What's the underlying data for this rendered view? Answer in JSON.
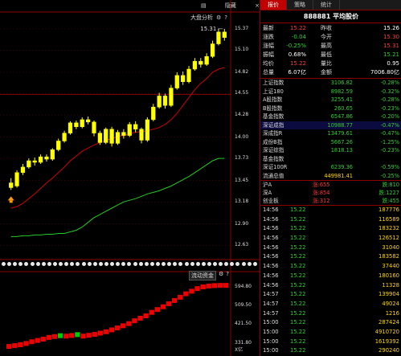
{
  "chart_toolbar": {
    "label": "大盘分析",
    "settings_icon": "⚙",
    "help_icon": "?"
  },
  "top_bar": {
    "icon": "▤",
    "hide_label": "隐藏",
    "close_icon": "×"
  },
  "price_axis": [
    "15.37",
    "15.10",
    "14.82",
    "14.55",
    "14.28",
    "14.00",
    "13.73",
    "13.45",
    "13.18",
    "12.90",
    "12.63"
  ],
  "price_marker": "15.31",
  "flow_header": {
    "label": "流动资金",
    "settings_icon": "⚙",
    "help_icon": "?"
  },
  "flow_axis": [
    "594.80",
    "509.50",
    "421.50",
    "331.80",
    "X亿"
  ],
  "colors": {
    "up": "#ffff00",
    "down": "#ffff00",
    "ma1": "#cc0000",
    "ma2": "#22cc22",
    "flow_up": "#ee0000",
    "flow_down": "#00cc00",
    "accent": "#c00000"
  },
  "chart_data": [
    {
      "type": "candlestick",
      "ylim": [
        12.5,
        15.45
      ],
      "y_ticks": [
        15.37,
        15.1,
        14.82,
        14.55,
        14.28,
        14.0,
        13.73,
        13.45,
        13.18,
        12.9,
        12.63
      ],
      "candles": [
        [
          13.42,
          13.36,
          13.48,
          13.33
        ],
        [
          13.38,
          13.55,
          13.58,
          13.36
        ],
        [
          13.55,
          13.62,
          13.66,
          13.52
        ],
        [
          13.62,
          13.7,
          13.73,
          13.6
        ],
        [
          13.7,
          13.68,
          13.74,
          13.64
        ],
        [
          13.68,
          13.75,
          13.78,
          13.66
        ],
        [
          13.75,
          13.72,
          13.78,
          13.69
        ],
        [
          13.72,
          13.84,
          13.86,
          13.7
        ],
        [
          13.84,
          13.95,
          13.98,
          13.82
        ],
        [
          13.95,
          14.05,
          14.08,
          13.93
        ],
        [
          14.05,
          14.18,
          14.2,
          14.03
        ],
        [
          14.18,
          14.13,
          14.21,
          14.1
        ],
        [
          14.13,
          14.22,
          14.25,
          14.11
        ],
        [
          14.22,
          14.19,
          14.26,
          14.16
        ],
        [
          14.19,
          14.05,
          14.21,
          14.01
        ],
        [
          14.05,
          13.93,
          14.08,
          13.9
        ],
        [
          13.93,
          14.1,
          14.12,
          13.91
        ],
        [
          14.1,
          13.92,
          14.13,
          13.88
        ],
        [
          13.92,
          14.06,
          14.09,
          13.9
        ],
        [
          14.06,
          14.02,
          14.1,
          13.98
        ],
        [
          14.02,
          14.16,
          14.19,
          14.0
        ],
        [
          14.16,
          14.1,
          14.2,
          14.06
        ],
        [
          14.1,
          13.96,
          14.12,
          13.92
        ],
        [
          13.96,
          14.22,
          14.25,
          13.94
        ],
        [
          14.22,
          14.38,
          14.42,
          14.2
        ],
        [
          14.38,
          14.52,
          14.56,
          14.36
        ],
        [
          14.52,
          14.4,
          14.55,
          14.36
        ],
        [
          14.4,
          14.62,
          14.66,
          14.38
        ],
        [
          14.62,
          14.78,
          14.82,
          14.6
        ],
        [
          14.78,
          14.7,
          14.83,
          14.66
        ],
        [
          14.7,
          14.86,
          14.9,
          14.68
        ],
        [
          14.86,
          14.96,
          15.0,
          14.84
        ],
        [
          14.96,
          14.92,
          15.0,
          14.88
        ],
        [
          14.92,
          15.02,
          15.06,
          14.9
        ],
        [
          15.02,
          15.18,
          15.22,
          15.0
        ],
        [
          15.18,
          15.33,
          15.37,
          15.16
        ],
        [
          15.33,
          15.26,
          15.37,
          15.22
        ]
      ],
      "ma1": [
        13.1,
        13.12,
        13.16,
        13.22,
        13.28,
        13.35,
        13.42,
        13.48,
        13.55,
        13.62,
        13.7,
        13.76,
        13.82,
        13.86,
        13.9,
        13.93,
        13.96,
        13.98,
        14.01,
        14.02,
        14.04,
        14.06,
        14.07,
        14.08,
        14.1,
        14.12,
        14.16,
        14.22,
        14.3,
        14.4,
        14.5,
        14.6,
        14.68,
        14.74,
        14.82,
        14.86,
        14.88
      ],
      "ma2": [
        12.74,
        12.74,
        12.75,
        12.75,
        12.76,
        12.76,
        12.77,
        12.77,
        12.78,
        12.78,
        12.8,
        12.82,
        12.86,
        12.92,
        12.98,
        13.02,
        13.06,
        13.1,
        13.14,
        13.18,
        13.2,
        13.22,
        13.25,
        13.28,
        13.3,
        13.32,
        13.35,
        13.38,
        13.42,
        13.46,
        13.5,
        13.55,
        13.6,
        13.65,
        13.7,
        13.73,
        13.73
      ]
    },
    {
      "type": "bar",
      "ylim": [
        300,
        620
      ],
      "values": [
        318,
        322,
        326,
        332,
        340,
        346,
        352,
        360,
        364,
        368,
        366,
        369,
        373,
        366,
        370,
        374,
        380,
        386,
        395,
        404,
        414,
        424,
        437,
        449,
        460,
        476,
        489,
        502,
        516,
        531,
        546,
        562,
        574,
        586,
        594,
        598,
        600,
        601,
        601
      ],
      "directions": [
        "up",
        "up",
        "up",
        "up",
        "up",
        "up",
        "up",
        "up",
        "up",
        "down",
        "up",
        "up",
        "down",
        "up",
        "up",
        "up",
        "up",
        "up",
        "up",
        "up",
        "up",
        "up",
        "up",
        "up",
        "up",
        "up",
        "up",
        "up",
        "up",
        "up",
        "up",
        "up",
        "up",
        "up",
        "up",
        "up",
        "up",
        "up",
        "up"
      ]
    }
  ],
  "panel": {
    "tabs": [
      "报价",
      "策略",
      "统计"
    ],
    "title": "888881 平均股价",
    "quote": [
      {
        "l1": "最新",
        "v1": "15.22",
        "c1": "red",
        "l2": "昨收",
        "v2": "15.26",
        "c2": "white"
      },
      {
        "l1": "涨跌",
        "v1": "-0.04",
        "c1": "green",
        "l2": "今开",
        "v2": "15.30",
        "c2": "red"
      },
      {
        "l1": "涨幅",
        "v1": "-0.25%",
        "c1": "green",
        "l2": "最高",
        "v2": "15.31",
        "c2": "red"
      },
      {
        "l1": "振幅",
        "v1": "0.68%",
        "c1": "white",
        "l2": "最低",
        "v2": "15.21",
        "c2": "green"
      },
      {
        "l1": "均价",
        "v1": "15.22",
        "c1": "red",
        "l2": "量比",
        "v2": "0.95",
        "c2": "white"
      },
      {
        "l1": "总量",
        "v1": "6.07亿",
        "c1": "white",
        "l2": "金额",
        "v2": "7006.80亿",
        "c2": "white"
      }
    ],
    "indices": [
      {
        "name": "上证指数",
        "value": "3106.82",
        "change": "-0.28%",
        "vc": "green",
        "cc": "green",
        "hl": false
      },
      {
        "name": "上证180",
        "value": "8982.59",
        "change": "-0.32%",
        "vc": "green",
        "cc": "green",
        "hl": false
      },
      {
        "name": "A股指数",
        "value": "3255.41",
        "change": "-0.28%",
        "vc": "green",
        "cc": "green",
        "hl": false
      },
      {
        "name": "B股指数",
        "value": "260.65",
        "change": "-0.23%",
        "vc": "green",
        "cc": "green",
        "hl": false
      },
      {
        "name": "基金指数",
        "value": "6547.86",
        "change": "-0.20%",
        "vc": "green",
        "cc": "green",
        "hl": false
      },
      {
        "name": "深证成指",
        "value": "10988.77",
        "change": "-0.47%",
        "vc": "green",
        "cc": "green",
        "hl": true
      },
      {
        "name": "深成指R",
        "value": "13479.61",
        "change": "-0.47%",
        "vc": "green",
        "cc": "green",
        "hl": false
      },
      {
        "name": "成份B指",
        "value": "5667.26",
        "change": "-1.25%",
        "vc": "green",
        "cc": "green",
        "hl": false
      },
      {
        "name": "深证综指",
        "value": "1818.13",
        "change": "-0.23%",
        "vc": "green",
        "cc": "green",
        "hl": false
      },
      {
        "name": "基金指数",
        "value": "",
        "change": "",
        "vc": "green",
        "cc": "green",
        "hl": false
      },
      {
        "name": "深证100R",
        "value": "6239.36",
        "change": "-0.59%",
        "vc": "green",
        "cc": "green",
        "hl": false
      },
      {
        "name": "流通总值",
        "value": "449981.41",
        "change": "-0.25%",
        "vc": "yellow",
        "cc": "green",
        "hl": false
      }
    ],
    "markets": [
      {
        "name": "沪A",
        "up_label": "涨:655",
        "down_label": "跌:810"
      },
      {
        "name": "深A",
        "up_label": "涨:854",
        "down_label": "跌:1227"
      },
      {
        "name": "创业板",
        "up_label": "涨:312",
        "down_label": "跌:455"
      }
    ],
    "ticks": [
      {
        "time": "14:56",
        "price": "15.22",
        "vol": "187776"
      },
      {
        "time": "14:56",
        "price": "15.22",
        "vol": "116589"
      },
      {
        "time": "14:56",
        "price": "15.22",
        "vol": "183232"
      },
      {
        "time": "14:56",
        "price": "15.22",
        "vol": "126512"
      },
      {
        "time": "14:56",
        "price": "15.22",
        "vol": "31040"
      },
      {
        "time": "14:56",
        "price": "15.22",
        "vol": "183582"
      },
      {
        "time": "14:56",
        "price": "15.22",
        "vol": "37440"
      },
      {
        "time": "14:56",
        "price": "15.22",
        "vol": "180160"
      },
      {
        "time": "14:56",
        "price": "15.22",
        "vol": "11328"
      },
      {
        "time": "14:57",
        "price": "15.22",
        "vol": "139904"
      },
      {
        "time": "14:57",
        "price": "15.22",
        "vol": "49024"
      },
      {
        "time": "14:57",
        "price": "15.22",
        "vol": "1216"
      },
      {
        "time": "15:00",
        "price": "15.22",
        "vol": "287424"
      },
      {
        "time": "15:00",
        "price": "15.22",
        "vol": "4910720"
      },
      {
        "time": "15:00",
        "price": "15.22",
        "vol": "1619392"
      },
      {
        "time": "15:00",
        "price": "15.22",
        "vol": "290240"
      }
    ]
  }
}
